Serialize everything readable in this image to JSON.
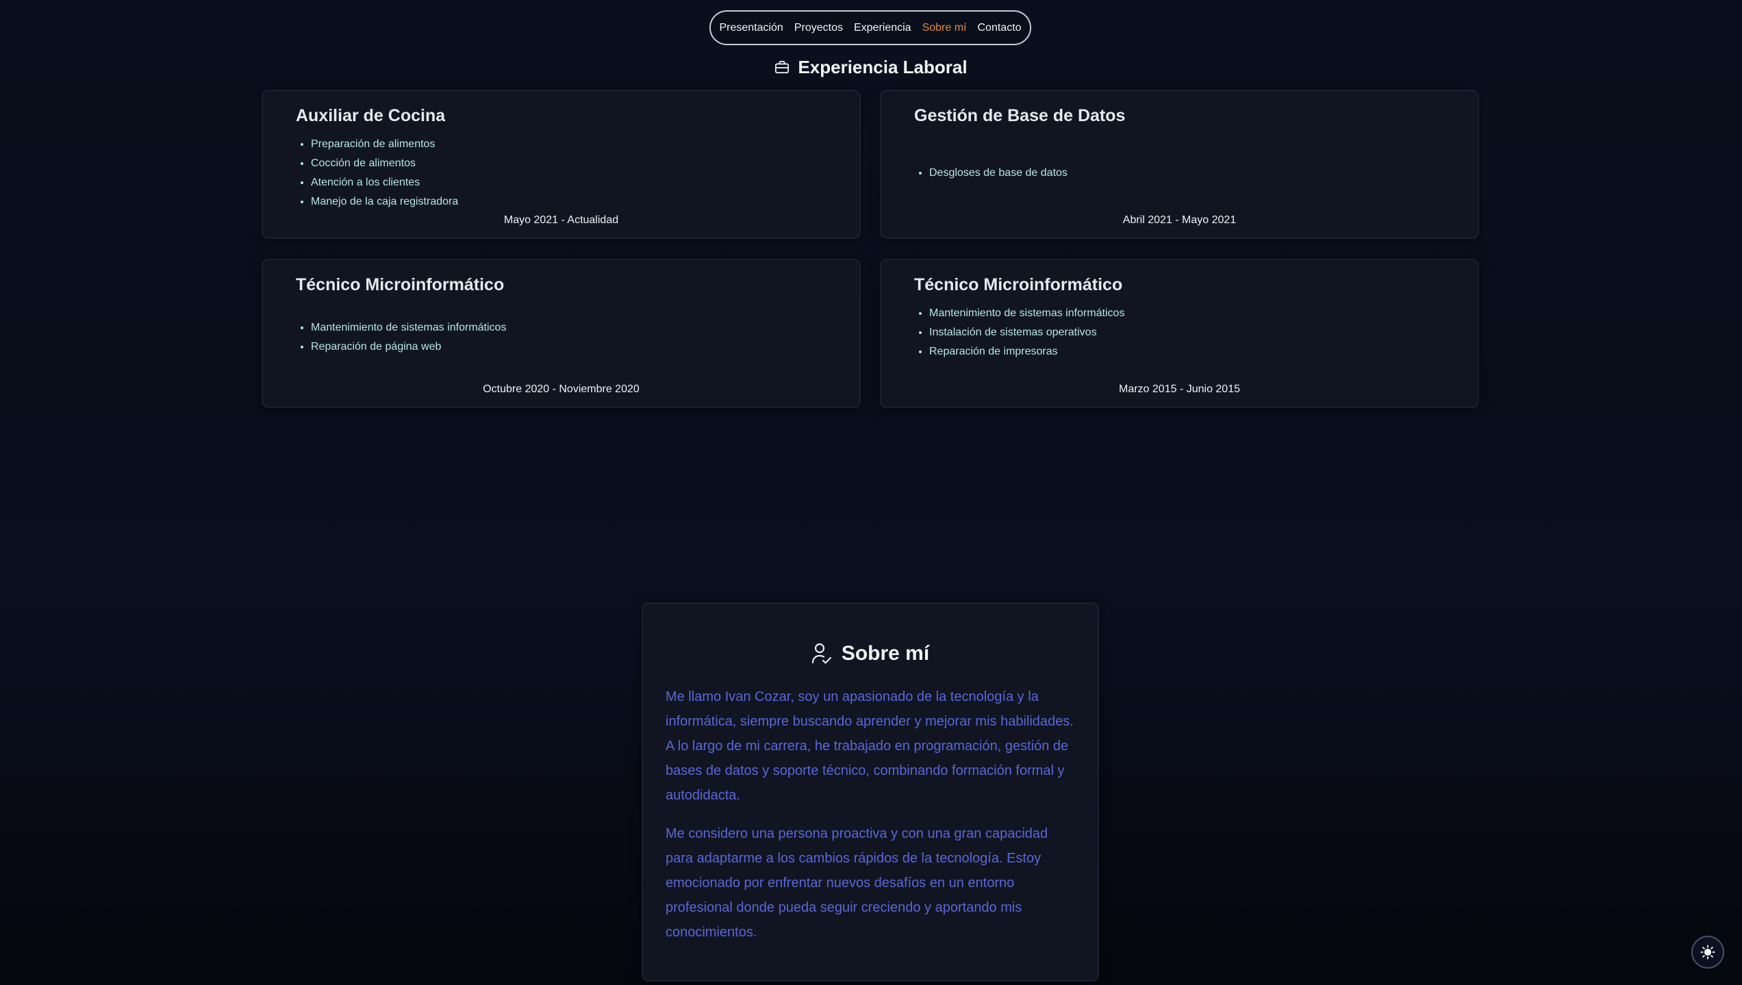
{
  "nav": {
    "items": [
      {
        "label": "Presentación",
        "active": false
      },
      {
        "label": "Proyectos",
        "active": false
      },
      {
        "label": "Experiencia",
        "active": false
      },
      {
        "label": "Sobre mí",
        "active": true
      },
      {
        "label": "Contacto",
        "active": false
      }
    ],
    "active_color": "#e48a3b"
  },
  "experience": {
    "title": "Experiencia Laboral",
    "icon": "briefcase-icon",
    "jobs": [
      {
        "title": "Auxiliar de Cocina",
        "tasks": [
          "Preparación de alimentos",
          "Cocción de alimentos",
          "Atención a los clientes",
          "Manejo de la caja registradora"
        ],
        "dates": "Mayo 2021 - Actualidad"
      },
      {
        "title": "Gestión de Base de Datos",
        "tasks": [
          "Desgloses de base de datos"
        ],
        "dates": "Abril 2021 - Mayo 2021"
      },
      {
        "title": "Técnico Microinformático",
        "tasks": [
          "Mantenimiento de sistemas informáticos",
          "Reparación de página web"
        ],
        "dates": "Octubre 2020 - Noviembre 2020"
      },
      {
        "title": "Técnico Microinformático",
        "tasks": [
          "Mantenimiento de sistemas informáticos",
          "Instalación de sistemas operativos",
          "Reparación de impresoras"
        ],
        "dates": "Marzo 2015 - Junio 2015"
      }
    ]
  },
  "about": {
    "title": "Sobre mí",
    "icon": "user-check-icon",
    "paragraphs": [
      "Me llamo Ivan Cozar, soy un apasionado de la tecnología y la informática, siempre buscando aprender y mejorar mis habilidades. A lo largo de mi carrera, he trabajado en programación, gestión de bases de datos y soporte técnico, combinando formación formal y autodidacta.",
      "Me considero una persona proactiva y con una gran capacidad para adaptarme a los cambios rápidos de la tecnología. Estoy emocionado por enfrentar nuevos desafíos en un entorno profesional donde pueda seguir creciendo y aportando mis conocimientos."
    ],
    "text_color": "#5a66d6"
  },
  "theme_toggle": {
    "icon": "sun-icon"
  }
}
